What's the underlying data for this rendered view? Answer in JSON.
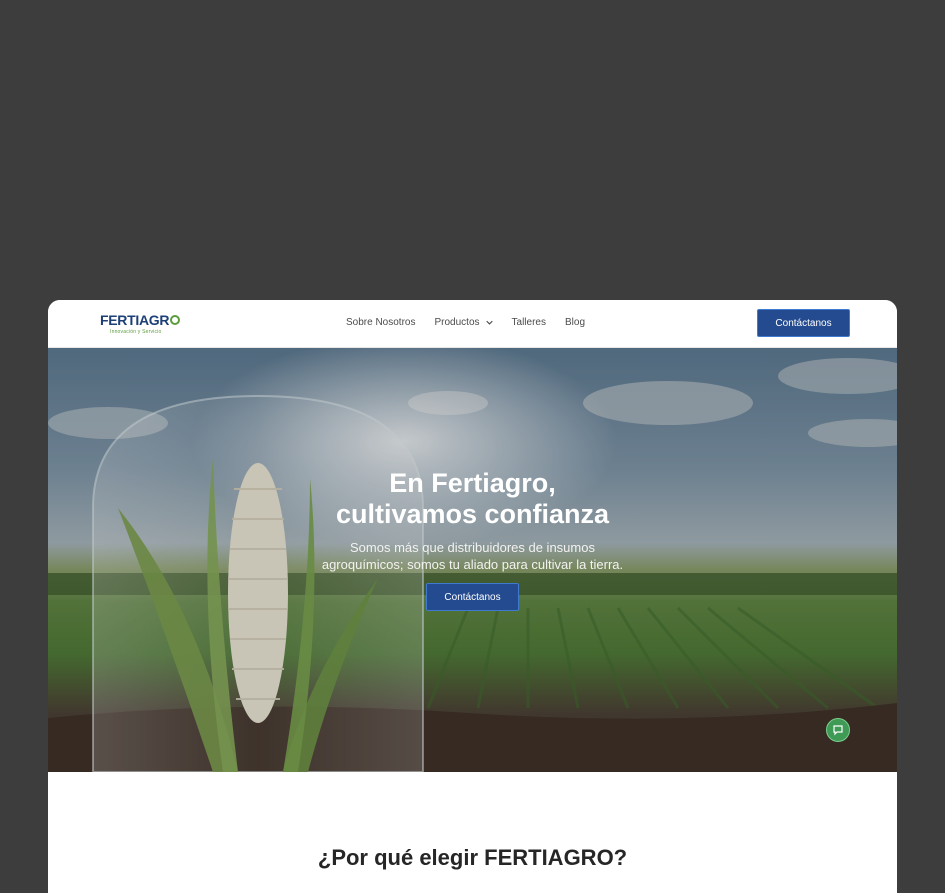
{
  "brand": {
    "name": "FERTIAGR",
    "tagline": "Innovación y Servicio",
    "colors": {
      "primary": "#244b8f",
      "accent": "#5b9c3d"
    }
  },
  "nav": {
    "items": [
      {
        "label": "Sobre Nosotros"
      },
      {
        "label": "Productos",
        "icon": "chevron-down-icon"
      },
      {
        "label": "Talleres"
      },
      {
        "label": "Blog"
      }
    ],
    "cta_label": "Contáctanos"
  },
  "hero": {
    "title_line1": "En Fertiagro,",
    "title_line2": "cultivamos confianza",
    "subtitle_line1": "Somos más que distribuidores de insumos",
    "subtitle_line2": "agroquímicos; somos tu aliado para cultivar la tierra.",
    "cta_label": "Contáctanos",
    "chat_icon": "chat-bubble-icon"
  },
  "section": {
    "title": "¿Por qué elegir FERTIAGRO?"
  }
}
